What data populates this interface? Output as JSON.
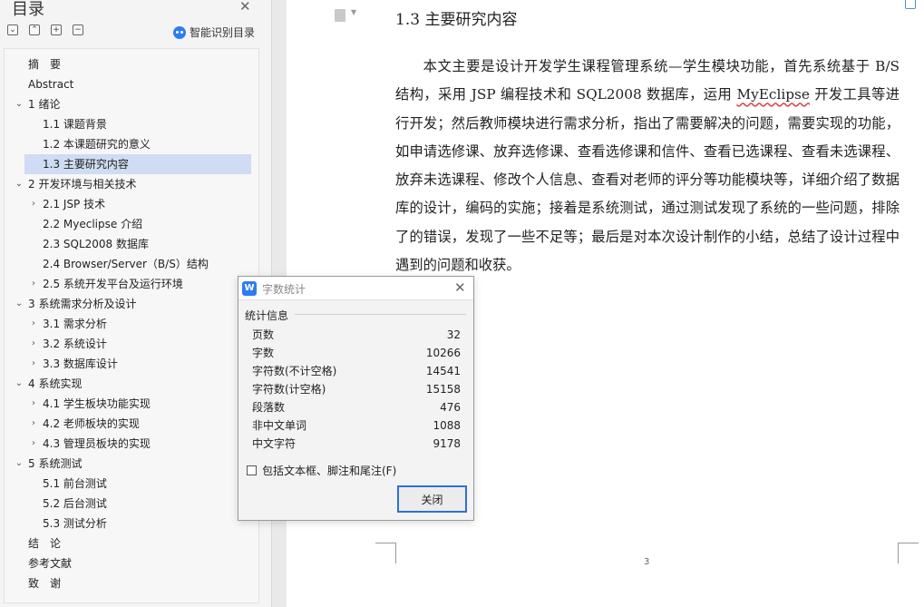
{
  "nav": {
    "title": "目录",
    "smart_toc_label": "智能识别目录",
    "tools": [
      "⌄",
      "⌃",
      "+",
      "−"
    ],
    "items": [
      {
        "label": "摘　要",
        "level": 0,
        "chev": ""
      },
      {
        "label": "Abstract",
        "level": 0,
        "chev": ""
      },
      {
        "label": "1  绪论",
        "level": 0,
        "chev": "⌄"
      },
      {
        "label": "1.1  课题背景",
        "level": 1,
        "chev": ""
      },
      {
        "label": "1.2  本课题研究的意义",
        "level": 1,
        "chev": ""
      },
      {
        "label": "1.3  主要研究内容",
        "level": 1,
        "chev": "",
        "active": true
      },
      {
        "label": "2  开发环境与相关技术",
        "level": 0,
        "chev": "⌄"
      },
      {
        "label": "2.1 JSP 技术",
        "level": 1,
        "chev": "›"
      },
      {
        "label": "2.2 Myeclipse 介绍",
        "level": 1,
        "chev": ""
      },
      {
        "label": "2.3 SQL2008  数据库",
        "level": 1,
        "chev": ""
      },
      {
        "label": "2.4 Browser/Server（B/S）结构",
        "level": 1,
        "chev": ""
      },
      {
        "label": "2.5 系统开发平台及运行环境",
        "level": 1,
        "chev": "›"
      },
      {
        "label": "3  系统需求分析及设计",
        "level": 0,
        "chev": "⌄"
      },
      {
        "label": "3.1  需求分析",
        "level": 1,
        "chev": "›"
      },
      {
        "label": "3.2  系统设计",
        "level": 1,
        "chev": "›"
      },
      {
        "label": "3.3  数据库设计",
        "level": 1,
        "chev": "›"
      },
      {
        "label": "4  系统实现",
        "level": 0,
        "chev": "⌄"
      },
      {
        "label": "4.1 学生板块功能实现",
        "level": 1,
        "chev": "›"
      },
      {
        "label": "4.2 老师板块的实现",
        "level": 1,
        "chev": "›"
      },
      {
        "label": "4.3 管理员板块的实现",
        "level": 1,
        "chev": "›"
      },
      {
        "label": "5  系统测试",
        "level": 0,
        "chev": "⌄"
      },
      {
        "label": "5.1  前台测试",
        "level": 1,
        "chev": ""
      },
      {
        "label": "5.2  后台测试",
        "level": 1,
        "chev": ""
      },
      {
        "label": "5.3 测试分析",
        "level": 1,
        "chev": ""
      },
      {
        "label": "结　论",
        "level": 0,
        "chev": ""
      },
      {
        "label": "参考文献",
        "level": 0,
        "chev": ""
      },
      {
        "label": "致　谢",
        "level": 0,
        "chev": ""
      }
    ]
  },
  "document": {
    "heading": "1.3  主要研究内容",
    "para_part1": "本文主要是设计开发学生课程管理系统—学生模块功能，首先系统基于 B/S 结构，采用 JSP 编程技术和 SQL2008 数据库，运用 ",
    "para_flagged": "MyEclipse",
    "para_part2": " 开发工具等进行开发；然后教师模块进行需求分析，指出了需要解决的问题，需要实现的功能，如申请选修课、放弃选修课、查看选修课和信件、查看已选课程、查看未选课程、放弃未选课程、修改个人信息、查看对老师的评分等功能模块等，详细介绍了数据库的设计，编码的实施；接着是系统测试，通过测试发现了系统的一些问题，排除了的错误，发现了一些不足等；最后是对本次设计制作的小结，总结了设计过程中遇到的问题和收获。",
    "page_number": "3"
  },
  "dialog": {
    "title": "字数统计",
    "section": "统计信息",
    "stats": [
      {
        "label": "页数",
        "value": "32"
      },
      {
        "label": "字数",
        "value": "10266"
      },
      {
        "label": "字符数(不计空格)",
        "value": "14541"
      },
      {
        "label": "字符数(计空格)",
        "value": "15158"
      },
      {
        "label": "段落数",
        "value": "476"
      },
      {
        "label": "非中文单词",
        "value": "1088"
      },
      {
        "label": "中文字符",
        "value": "9178"
      }
    ],
    "checkbox_label": "包括文本框、脚注和尾注(F)",
    "checkbox_checked": false,
    "close_label": "关闭",
    "logo_text": "W",
    "close_icon": "✕"
  },
  "colors": {
    "accent": "#2f7cf0",
    "active_toc": "#cfdcf3"
  }
}
